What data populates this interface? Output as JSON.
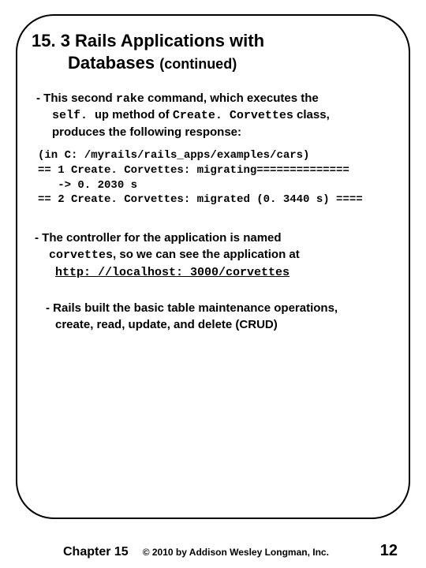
{
  "title": {
    "line1": "15. 3 Rails Applications with",
    "line2_main": "Databases",
    "line2_contd": "(continued)"
  },
  "bullet1": {
    "prefix": "- This second ",
    "code1": "rake",
    "mid1": " command, which executes the",
    "code2": "self. up",
    "mid2": " method of ",
    "code3": "Create. Corvettes",
    "mid3": " class,",
    "line3": "produces the following response:"
  },
  "code": {
    "l1": "(in C: /myrails/rails_apps/examples/cars)",
    "l2": "== 1 Create. Corvettes: migrating==============",
    "l3": "   -> 0. 2030 s",
    "l4": "== 2 Create. Corvettes: migrated (0. 3440 s) ===="
  },
  "bullet2": {
    "prefix": "- The controller for the application is named",
    "code1": "corvettes",
    "mid1": ", so we can see the application at",
    "url": "http: //localhost: 3000/corvettes"
  },
  "bullet3": {
    "l1": "- Rails built the basic table maintenance operations,",
    "l2": "create, read, update, and delete (CRUD)"
  },
  "footer": {
    "chapter": "Chapter 15",
    "copyright": "© 2010 by Addison Wesley Longman, Inc.",
    "page": "12"
  }
}
